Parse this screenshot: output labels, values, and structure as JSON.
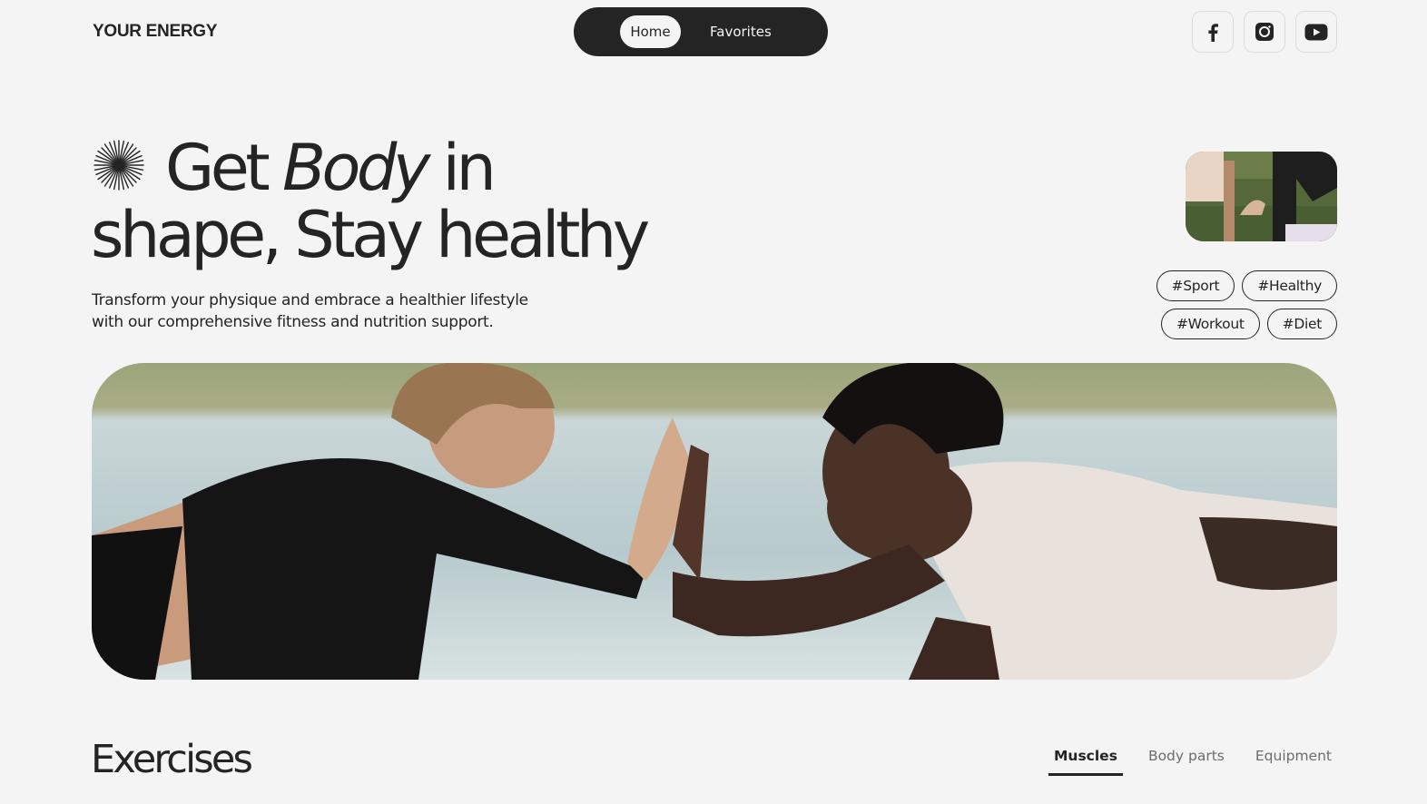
{
  "header": {
    "logo": "YOUR ENERGY",
    "nav": {
      "home": "Home",
      "favorites": "Favorites"
    },
    "socials": [
      "facebook-icon",
      "instagram-icon",
      "youtube-icon"
    ]
  },
  "hero": {
    "title_part1": "Get",
    "title_italic": "Body",
    "title_part2": "in",
    "title_line2": "shape, Stay healthy",
    "subtitle": "Transform your physique and embrace a healthier lifestyle with our comprehensive fitness and nutrition support.",
    "tags": [
      "#Sport",
      "#Healthy",
      "#Workout",
      "#Diet"
    ]
  },
  "exercises": {
    "title": "Exercises",
    "filters": [
      "Muscles",
      "Body parts",
      "Equipment"
    ],
    "active_filter": "Muscles"
  },
  "colors": {
    "dark": "#242424",
    "background": "#f4f4f4"
  }
}
